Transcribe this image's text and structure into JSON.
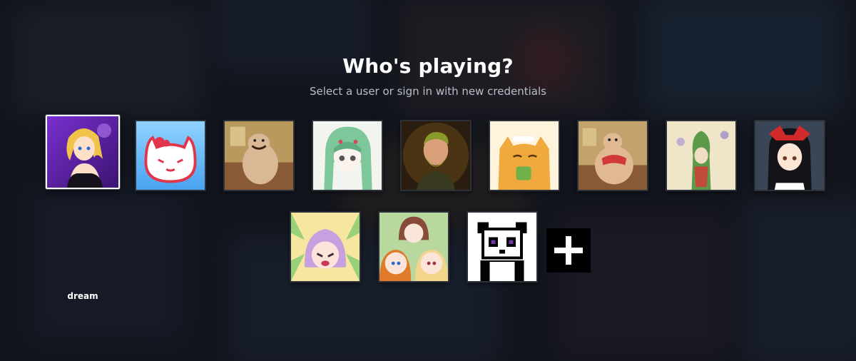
{
  "header": {
    "title": "Who's playing?",
    "subtitle": "Select a user or sign in with new credentials"
  },
  "selected_user": {
    "name": "dream"
  },
  "avatars": [
    {
      "icon": "anime-girl-blonde-avatar-icon",
      "selected": true
    },
    {
      "icon": "pink-cat-face-avatar-icon"
    },
    {
      "icon": "pig-creature-avatar-icon"
    },
    {
      "icon": "green-hair-anime-girl-avatar-icon"
    },
    {
      "icon": "bearded-man-portrait-avatar-icon"
    },
    {
      "icon": "orange-cat-tea-avatar-icon"
    },
    {
      "icon": "pig-creature-red-avatar-icon"
    },
    {
      "icon": "green-creature-cartoon-avatar-icon"
    },
    {
      "icon": "shrine-maiden-anime-avatar-icon"
    },
    {
      "icon": "crying-purple-hair-girl-avatar-icon"
    },
    {
      "icon": "anime-girls-group-avatar-icon"
    },
    {
      "icon": "pixel-panda-avatar-icon"
    }
  ],
  "add_account": {
    "icon": "plus-icon"
  },
  "colors": {
    "background": "#161a22",
    "selected_border": "#ffffff",
    "subtitle": "#b8bec8"
  }
}
